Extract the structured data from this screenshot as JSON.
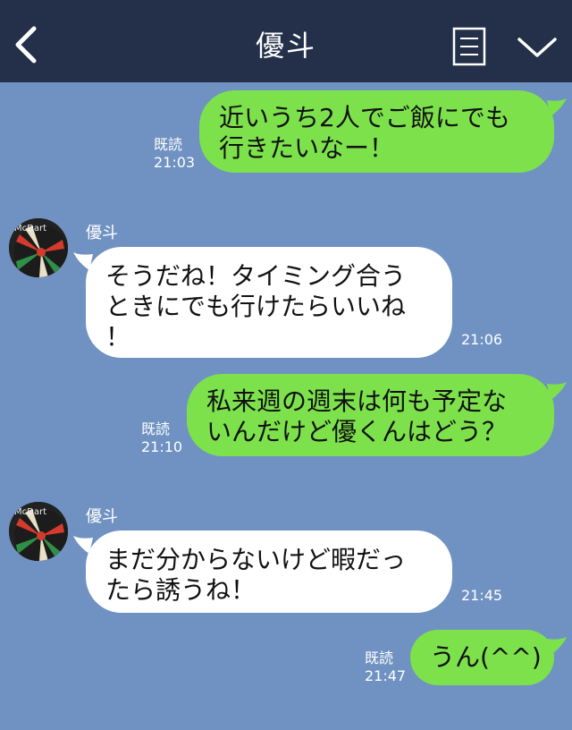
{
  "header": {
    "title": "優斗",
    "back_icon": "chevron-left-icon",
    "notes_icon": "notes-icon",
    "menu_icon": "chevron-down-icon",
    "bg_color": "#243049"
  },
  "chat": {
    "bg_color": "#7092c2",
    "outgoing_color": "#7de14c",
    "incoming_color": "#ffffff",
    "messages": [
      {
        "direction": "out",
        "text": "近いうち2人でご飯にでも\n行きたいなー！",
        "read_label": "既読",
        "time": "21:03"
      },
      {
        "direction": "in",
        "sender": "優斗",
        "text": "そうだね！タイミング合う\nときにでも行けたらいいね\n！",
        "time": "21:06"
      },
      {
        "direction": "out",
        "text": "私来週の週末は何も予定な\nいんだけど優くんはどう？",
        "read_label": "既読",
        "time": "21:10"
      },
      {
        "direction": "in",
        "sender": "優斗",
        "text": "まだ分からないけど暇だっ\nたら誘うね！",
        "time": "21:45"
      },
      {
        "direction": "out",
        "text": "うん(^^)",
        "read_label": "既読",
        "time": "21:47"
      }
    ]
  }
}
